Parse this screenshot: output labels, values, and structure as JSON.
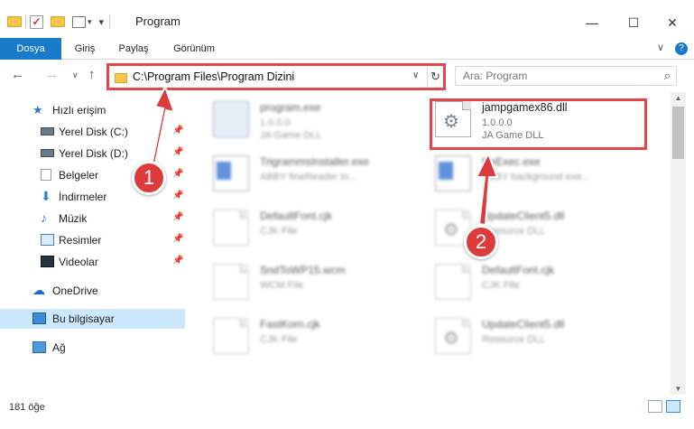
{
  "window": {
    "title": "Program",
    "minimize": "—",
    "maximize": "☐",
    "close": "✕"
  },
  "ribbon": {
    "tabs": [
      "Dosya",
      "Giriş",
      "Paylaş",
      "Görünüm"
    ],
    "expand": "∨",
    "help": "?"
  },
  "addressbar": {
    "path": "C:\\Program Files\\Program Dizini",
    "search_placeholder": "Ara: Program"
  },
  "nav": {
    "items": [
      {
        "label": "Hızlı erişim",
        "icon": "quick-access-icon",
        "pinned": false
      },
      {
        "label": "Yerel Disk (C:)",
        "icon": "drive-icon",
        "pinned": true
      },
      {
        "label": "Yerel Disk (D:)",
        "icon": "drive-icon",
        "pinned": true
      },
      {
        "label": "Belgeler",
        "icon": "documents-icon",
        "pinned": true
      },
      {
        "label": "İndirmeler",
        "icon": "downloads-icon",
        "pinned": true
      },
      {
        "label": "Müzik",
        "icon": "music-icon",
        "pinned": true
      },
      {
        "label": "Resimler",
        "icon": "pictures-icon",
        "pinned": true
      },
      {
        "label": "Videolar",
        "icon": "videos-icon",
        "pinned": true
      },
      {
        "label": "OneDrive",
        "icon": "onedrive-icon",
        "pinned": false
      },
      {
        "label": "Bu bilgisayar",
        "icon": "this-pc-icon",
        "pinned": false,
        "selected": true
      },
      {
        "label": "Ağ",
        "icon": "network-icon",
        "pinned": false
      }
    ]
  },
  "files": [
    {
      "name": "program.exe",
      "line2": "1.0.0.0",
      "line3": "JA Game DLL",
      "icon": "exe-icon",
      "blurred": true
    },
    {
      "name": "jampgamex86.dll",
      "line2": "1.0.0.0",
      "line3": "JA Game DLL",
      "icon": "dll-gear-icon",
      "blurred": false,
      "highlighted": true
    },
    {
      "name": "TrigrammsInstaller.exe",
      "line2": "ABBY fineReader tri...",
      "line3": "",
      "icon": "app-icon",
      "blurred": true
    },
    {
      "name": "NeExec.exe",
      "line2": "ABBY background exe...",
      "line3": "",
      "icon": "app-icon",
      "blurred": true
    },
    {
      "name": "DefaultFont.cjk",
      "line2": "CJK File",
      "line3": "",
      "icon": "document-icon",
      "blurred": true
    },
    {
      "name": "UpdateClient5.dll",
      "line2": "Resource DLL",
      "line3": "",
      "icon": "dll-gear-icon",
      "blurred": true
    },
    {
      "name": "SndToWP15.wcm",
      "line2": "WCM File",
      "line3": "",
      "icon": "document-icon",
      "blurred": true
    },
    {
      "name": "DefaultFont.cjk",
      "line2": "CJK File",
      "line3": "",
      "icon": "document-icon",
      "blurred": true
    },
    {
      "name": "FastKorn.cjk",
      "line2": "CJK File",
      "line3": "",
      "icon": "document-icon",
      "blurred": true
    },
    {
      "name": "UpdateClient5.dll",
      "line2": "Resource DLL",
      "line3": "",
      "icon": "dll-gear-icon",
      "blurred": true
    }
  ],
  "status": {
    "count": "181 öğe"
  },
  "callouts": {
    "one": "1",
    "two": "2"
  },
  "colors": {
    "accent": "#1979ca",
    "highlight": "#e0474c",
    "selection": "#cce8ff"
  }
}
